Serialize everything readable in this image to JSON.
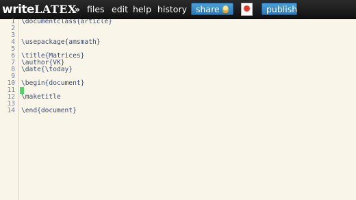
{
  "topbar": {
    "logo": {
      "write": "write",
      "latex": "LATEX"
    },
    "chevron": "»",
    "menu": {
      "files": "files",
      "edit": "edit",
      "help": "help",
      "history": "history"
    },
    "share_label": "share",
    "publish_label": "publish",
    "icons": [
      "share-bulb-icon",
      "pdf-icon"
    ]
  },
  "editor": {
    "lines": [
      {
        "num": "1",
        "text": "\\documentclass{article}"
      },
      {
        "num": "2",
        "text": ""
      },
      {
        "num": "3",
        "text": ""
      },
      {
        "num": "4",
        "text": "\\usepackage{amsmath}"
      },
      {
        "num": "5",
        "text": ""
      },
      {
        "num": "6",
        "text": "\\title{Matrices}"
      },
      {
        "num": "7",
        "text": "\\author{VK}"
      },
      {
        "num": "8",
        "text": "\\date{\\today}"
      },
      {
        "num": "9",
        "text": ""
      },
      {
        "num": "10",
        "text": "\\begin{document}"
      },
      {
        "num": "11",
        "text": ""
      },
      {
        "num": "12",
        "text": "\\maketitle"
      },
      {
        "num": "13",
        "text": ""
      },
      {
        "num": "14",
        "text": "\\end{document}"
      }
    ],
    "cursor_line": 11,
    "colors": {
      "background": "#f9f5e8",
      "line_numbers": "#6f7fa8",
      "code": "#384a78",
      "cursor": "#4cd964"
    }
  }
}
